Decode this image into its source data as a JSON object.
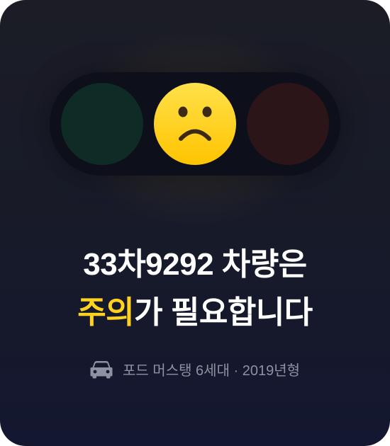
{
  "signal": {
    "active_light": "yellow",
    "lights": [
      {
        "name": "green",
        "color": "#0f2b25",
        "state": "off"
      },
      {
        "name": "yellow",
        "color": "#ffd21f",
        "state": "on",
        "face": "frowning-face-icon"
      },
      {
        "name": "red",
        "color": "#2b1518",
        "state": "off"
      }
    ]
  },
  "headline": {
    "line1": "33차9292 차량은",
    "line2_accent": "주의",
    "line2_rest": "가 필요합니다",
    "accent_color": "#ffd21f"
  },
  "vehicle": {
    "icon": "car-icon",
    "description": "포드 머스탱 6세대 · 2019년형"
  }
}
